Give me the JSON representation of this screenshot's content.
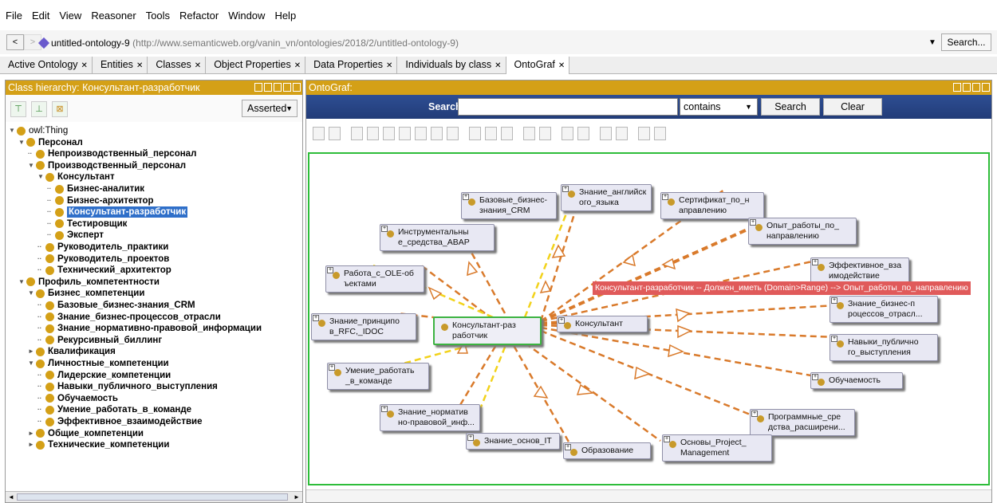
{
  "menu": [
    "File",
    "Edit",
    "View",
    "Reasoner",
    "Tools",
    "Refactor",
    "Window",
    "Help"
  ],
  "address": {
    "back": "<",
    "forward": ">",
    "ontology_name": "untitled-ontology-9",
    "ontology_iri": "(http://www.semanticweb.org/vanin_vn/ontologies/2018/2/untitled-ontology-9)",
    "search_button": "Search..."
  },
  "tabs": [
    {
      "label": "Active Ontology",
      "active": false
    },
    {
      "label": "Entities",
      "active": false
    },
    {
      "label": "Classes",
      "active": false
    },
    {
      "label": "Object Properties",
      "active": false
    },
    {
      "label": "Data Properties",
      "active": false
    },
    {
      "label": "Individuals by class",
      "active": false
    },
    {
      "label": "OntoGraf",
      "active": true
    }
  ],
  "left_panel": {
    "title": "Class hierarchy: Консультант-разработчик",
    "mode": "Asserted",
    "tree": [
      {
        "label": "owl:Thing",
        "bold": false,
        "toggle": "▼"
      },
      {
        "label": "Персонал",
        "bold": true,
        "toggle": "▼"
      },
      {
        "label": "Непроизводственный_персонал",
        "bold": true,
        "toggle": ""
      },
      {
        "label": "Производственный_персонал",
        "bold": true,
        "toggle": "▼"
      },
      {
        "label": "Консультант",
        "bold": true,
        "toggle": "▼"
      },
      {
        "label": "Бизнес-аналитик",
        "bold": true,
        "toggle": ""
      },
      {
        "label": "Бизнес-архитектор",
        "bold": true,
        "toggle": ""
      },
      {
        "label": "Консультант-разработчик",
        "bold": true,
        "toggle": "",
        "selected": true
      },
      {
        "label": "Тестировщик",
        "bold": true,
        "toggle": ""
      },
      {
        "label": "Эксперт",
        "bold": true,
        "toggle": ""
      },
      {
        "label": "Руководитель_практики",
        "bold": true,
        "toggle": ""
      },
      {
        "label": "Руководитель_проектов",
        "bold": true,
        "toggle": ""
      },
      {
        "label": "Технический_архитектор",
        "bold": true,
        "toggle": ""
      },
      {
        "label": "Профиль_компетентности",
        "bold": true,
        "toggle": "▼"
      },
      {
        "label": "Бизнес_компетенции",
        "bold": true,
        "toggle": "▼"
      },
      {
        "label": "Базовые_бизнес-знания_CRM",
        "bold": true,
        "toggle": ""
      },
      {
        "label": "Знание_бизнес-процессов_отрасли",
        "bold": true,
        "toggle": ""
      },
      {
        "label": "Знание_нормативно-правовой_информации",
        "bold": true,
        "toggle": ""
      },
      {
        "label": "Рекурсивный_биллинг",
        "bold": true,
        "toggle": ""
      },
      {
        "label": "Квалификация",
        "bold": true,
        "toggle": "►"
      },
      {
        "label": "Личностные_компетенции",
        "bold": true,
        "toggle": "▼"
      },
      {
        "label": "Лидерские_компетенции",
        "bold": true,
        "toggle": ""
      },
      {
        "label": "Навыки_публичного_выступления",
        "bold": true,
        "toggle": ""
      },
      {
        "label": "Обучаемость",
        "bold": true,
        "toggle": ""
      },
      {
        "label": "Умение_работать_в_команде",
        "bold": true,
        "toggle": ""
      },
      {
        "label": "Эффективное_взаимодействие",
        "bold": true,
        "toggle": ""
      },
      {
        "label": "Общие_компетенции",
        "bold": true,
        "toggle": "►"
      },
      {
        "label": "Технические_компетенции",
        "bold": true,
        "toggle": "►"
      }
    ]
  },
  "right_panel": {
    "title": "OntoGraf:",
    "search_label": "Search:",
    "search_value": "",
    "match_mode": "contains",
    "search_button": "Search",
    "clear_button": "Clear",
    "tooltip": "Консультант-разработчик -- Должен_иметь (Domain>Range) --> Опыт_работы_по_направлению",
    "nodes": {
      "center": "Консультант-раз работчик",
      "n1": "Базовые_бизнес-знания_CRM",
      "n2": "Знание_английск ого_языка",
      "n3": "Сертификат_по_н аправлению",
      "n4": "Опыт_работы_по_ направлению",
      "n5": "Инструментальны е_средства_ABAP",
      "n6": "Работа_с_OLE-об ъектами",
      "n7": "Эффективное_вза имодействие",
      "n8": "Знание_бизнес-п роцессов_отрасл...",
      "n9": "Знание_принципо в_RFC,_IDOC",
      "n10": "Консультант",
      "n11": "Навыки_публично го_выступления",
      "n12": "Умение_работать _в_команде",
      "n13": "Обучаемость",
      "n14": "Знание_норматив но-правовой_инф...",
      "n15": "Программные_сре дства_расширени...",
      "n16": "Знание_основ_IT",
      "n17": "Образование",
      "n18": "Основы_Project_ Management"
    }
  },
  "colors": {
    "panel_header": "#d4a017",
    "search_bar": "#2e4e93",
    "canvas_border": "#2ebd3a",
    "edge_orange": "#d97a2b",
    "edge_yellow": "#f2d21b",
    "tooltip": "#e05a5a",
    "selection": "#2f6fc9"
  }
}
